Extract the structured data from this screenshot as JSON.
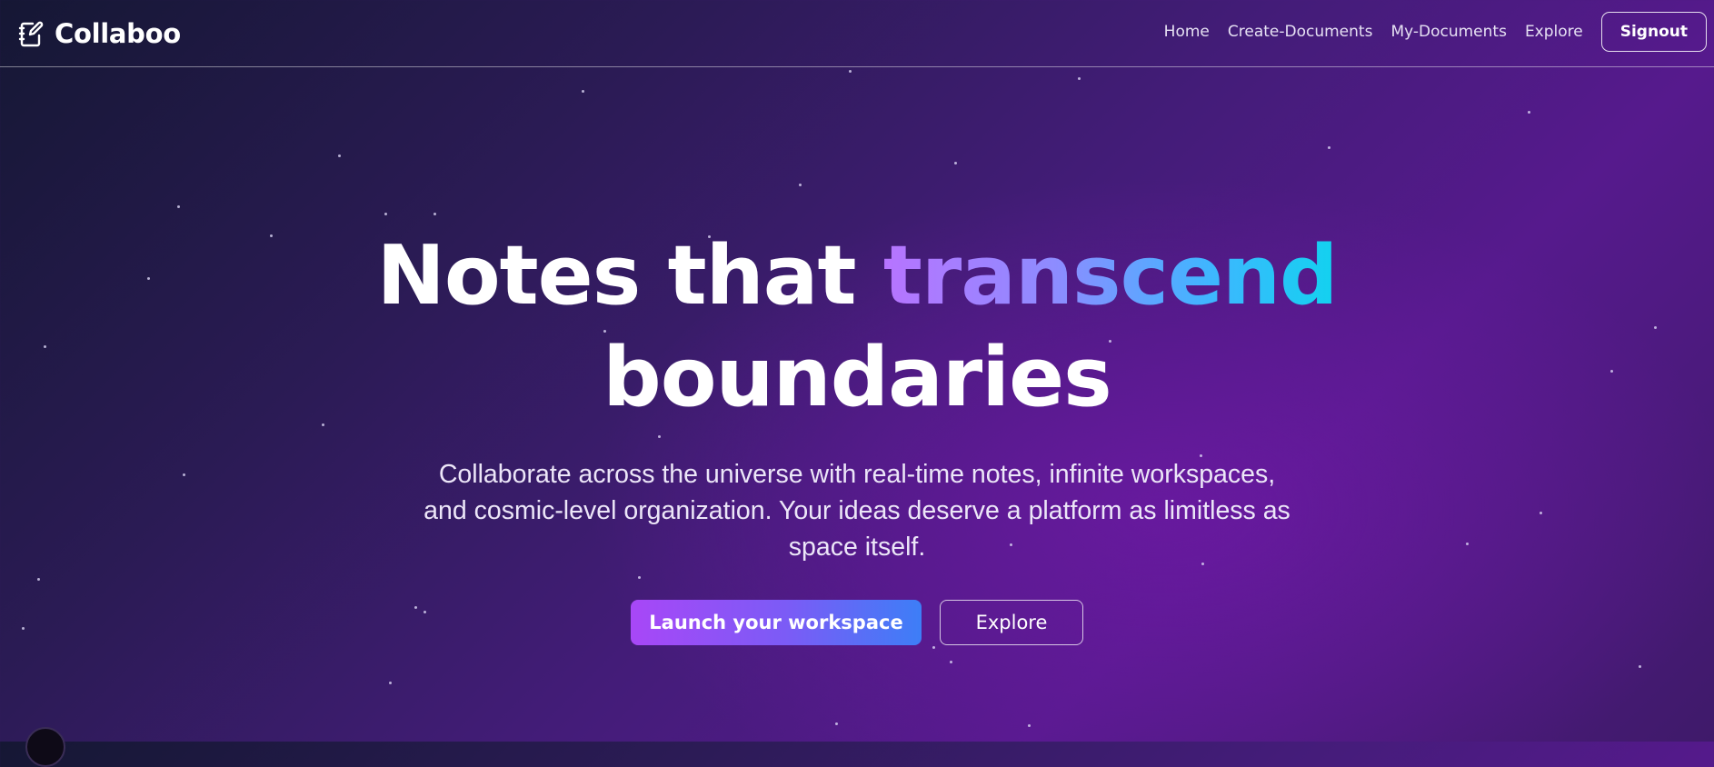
{
  "header": {
    "brand": {
      "name": "Collaboo",
      "icon": "notebook-pen-icon"
    },
    "nav": [
      {
        "label": "Home"
      },
      {
        "label": "Create-Documents"
      },
      {
        "label": "My-Documents"
      },
      {
        "label": "Explore"
      }
    ],
    "signout_label": "Signout"
  },
  "hero": {
    "headline_part1": "Notes that ",
    "headline_accent": "transcend",
    "headline_part2": "boundaries",
    "subtitle": "Collaborate across the universe with real-time notes, infinite workspaces, and cosmic-level organization. Your ideas deserve a platform as limitless as space itself.",
    "primary_cta": "Launch your workspace",
    "secondary_cta": "Explore"
  },
  "colors": {
    "accent_gradient_start": "#b774ff",
    "accent_gradient_end": "#12d2ef",
    "primary_button_start": "#a847f7",
    "primary_button_end": "#3d7ef7",
    "background_dark": "#151734",
    "background_purple": "#561a8d"
  }
}
